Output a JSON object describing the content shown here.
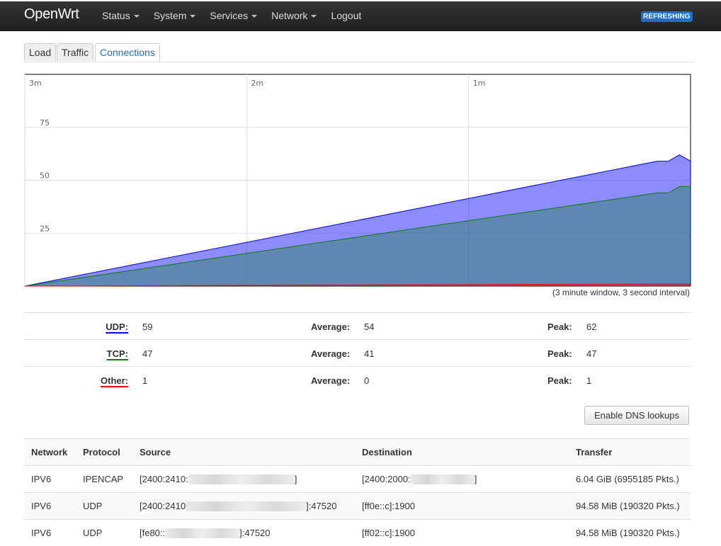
{
  "navbar": {
    "brand": "OpenWrt",
    "menu": [
      {
        "label": "Status",
        "dropdown": true
      },
      {
        "label": "System",
        "dropdown": true
      },
      {
        "label": "Services",
        "dropdown": true
      },
      {
        "label": "Network",
        "dropdown": true
      },
      {
        "label": "Logout",
        "dropdown": false
      }
    ],
    "badge": "REFRESHING"
  },
  "tabs": [
    {
      "label": "Load",
      "active": false
    },
    {
      "label": "Traffic",
      "active": false
    },
    {
      "label": "Connections",
      "active": true
    }
  ],
  "chart_data": {
    "type": "area",
    "x_unit": "seconds ago",
    "x_tick_labels": [
      "3m",
      "2m",
      "1m"
    ],
    "y_tick_labels": [
      "75",
      "50",
      "25"
    ],
    "ylim": [
      0,
      100
    ],
    "grid": true,
    "series": [
      {
        "name": "UDP",
        "color": "#0000ff",
        "x": [
          180,
          9,
          6,
          3,
          0
        ],
        "values": [
          0,
          59,
          59,
          62,
          59
        ]
      },
      {
        "name": "TCP",
        "color": "#008000",
        "x": [
          180,
          9,
          6,
          3,
          0
        ],
        "values": [
          0,
          44,
          44,
          47,
          47
        ]
      },
      {
        "name": "Other",
        "color": "#ff0000",
        "x": [
          180,
          9,
          6,
          3,
          0
        ],
        "values": [
          0,
          1,
          1,
          1,
          1
        ]
      }
    ]
  },
  "window_note": "(3 minute window, 3 second interval)",
  "stats": [
    {
      "label": "UDP:",
      "color": "#0000ff",
      "current": "59",
      "average_label": "Average:",
      "average": "54",
      "peak_label": "Peak:",
      "peak": "62"
    },
    {
      "label": "TCP:",
      "color": "#008000",
      "current": "47",
      "average_label": "Average:",
      "average": "41",
      "peak_label": "Peak:",
      "peak": "47"
    },
    {
      "label": "Other:",
      "color": "#ff0000",
      "current": "1",
      "average_label": "Average:",
      "average": "0",
      "peak_label": "Peak:",
      "peak": "1"
    }
  ],
  "dns_button": "Enable DNS lookups",
  "table": {
    "headers": [
      "Network",
      "Protocol",
      "Source",
      "Destination",
      "Transfer"
    ],
    "rows": [
      {
        "network": "IPV6",
        "protocol": "IPENCAP",
        "source_prefix": "[2400:2410:",
        "source_suffix": "]",
        "destination_prefix": "[2400:2000:",
        "destination_suffix": "]",
        "transfer": "6.04 GiB (6955185 Pkts.)"
      },
      {
        "network": "IPV6",
        "protocol": "UDP",
        "source_prefix": "[2400:2410",
        "source_suffix": "]:47520",
        "destination_prefix": "[ff0e::c]:1900",
        "destination_suffix": "",
        "transfer": "94.58 MiB (190320 Pkts.)"
      },
      {
        "network": "IPV6",
        "protocol": "UDP",
        "source_prefix": "[fe80::",
        "source_suffix": "]:47520",
        "destination_prefix": "[ff02::c]:1900",
        "destination_suffix": "",
        "transfer": "94.58 MiB (190320 Pkts.)"
      }
    ]
  }
}
